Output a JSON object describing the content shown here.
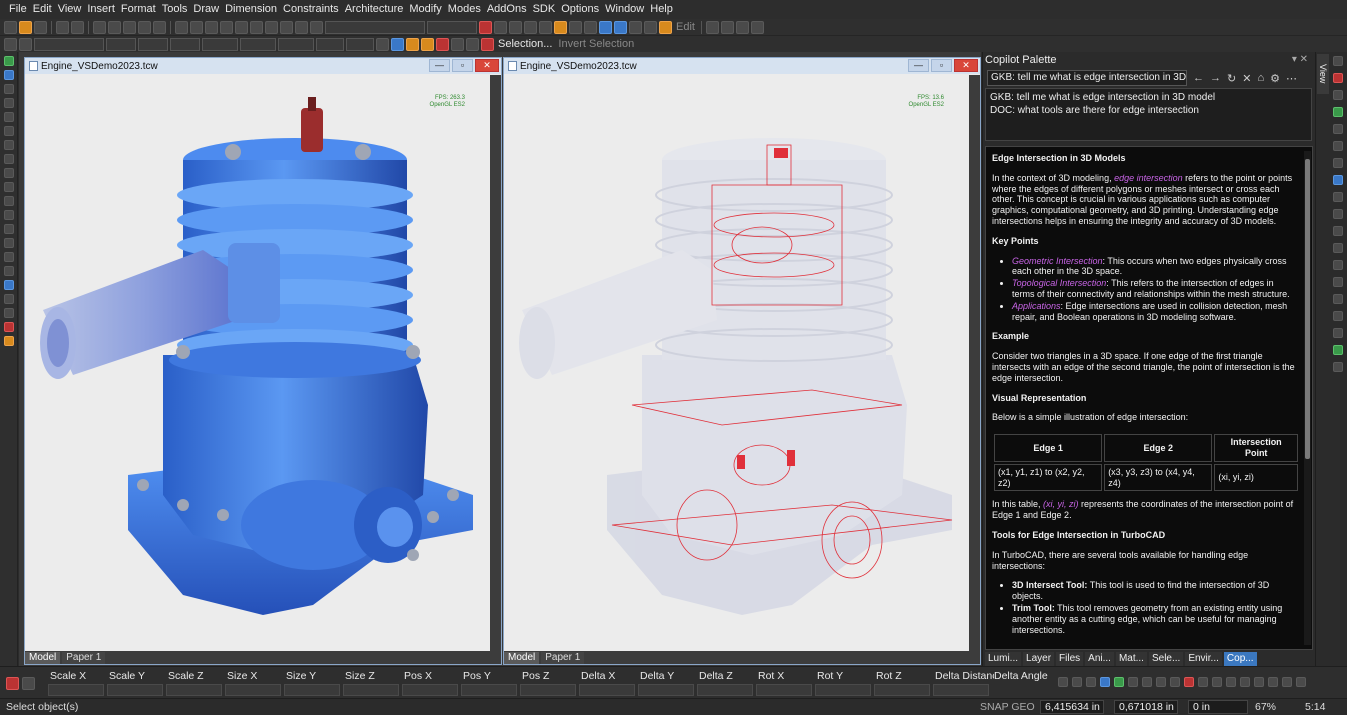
{
  "menu": [
    "File",
    "Edit",
    "View",
    "Insert",
    "Format",
    "Tools",
    "Draw",
    "Dimension",
    "Constraints",
    "Architecture",
    "Modify",
    "Modes",
    "AddOns",
    "SDK",
    "Options",
    "Window",
    "Help"
  ],
  "toolbar": {
    "edit_label": "Edit",
    "selection_label": "Selection...",
    "invert_selection_label": "Invert Selection"
  },
  "viewports": [
    {
      "title": "Engine_VSDemo2023.tcw",
      "fps": "FPS: 263.3",
      "renderer": "OpenGL ES2",
      "tab_model": "Model",
      "tab_paper": "Paper 1"
    },
    {
      "title": "Engine_VSDemo2023.tcw",
      "fps": "FPS: 13.6",
      "renderer": "OpenGL ES2",
      "tab_model": "Model",
      "tab_paper": "Paper 1"
    }
  ],
  "copilot": {
    "title": "Copilot Palette",
    "combo_value": "GKB: tell me what is edge intersection in 3D m",
    "history": [
      "GKB: tell me what is edge intersection in 3D model",
      "DOC:  what tools are there for edge intersection"
    ],
    "heading": "Edge Intersection in 3D Models",
    "intro_pre": "In the context of 3D modeling, ",
    "intro_term": "edge intersection",
    "intro_post": " refers to the point or points where the edges of different polygons or meshes intersect or cross each other. This concept is crucial in various applications such as computer graphics, computational geometry, and 3D printing. Understanding edge intersections helps in ensuring the integrity and accuracy of 3D models.",
    "key_points_heading": "Key Points",
    "key_points": [
      {
        "term": "Geometric Intersection",
        "text": ": This occurs when two edges physically cross each other in the 3D space."
      },
      {
        "term": "Topological Intersection",
        "text": ": This refers to the intersection of edges in terms of their connectivity and relationships within the mesh structure."
      },
      {
        "term": "Applications",
        "text": ": Edge intersections are used in collision detection, mesh repair, and Boolean operations in 3D modeling software."
      }
    ],
    "example_heading": "Example",
    "example_text": "Consider two triangles in a 3D space. If one edge of the first triangle intersects with an edge of the second triangle, the point of intersection is the edge intersection.",
    "visual_heading": "Visual Representation",
    "visual_text": "Below is a simple illustration of edge intersection:",
    "table": {
      "headers": [
        "Edge 1",
        "Edge 2",
        "Intersection Point"
      ],
      "row": [
        "(x1, y1, z1) to (x2, y2, z2)",
        "(x3, y3, z3) to (x4, y4, z4)",
        "(xi, yi, zi)"
      ]
    },
    "table_note_pre": "In this table, ",
    "table_note_term": "(xi, yi, zi)",
    "table_note_post": " represents the coordinates of the intersection point of Edge 1 and Edge 2.",
    "tools_heading": "Tools for Edge Intersection in TurboCAD",
    "tools_intro": "In TurboCAD, there are several tools available for handling edge intersections:",
    "tools": [
      {
        "name": "3D Intersect Tool:",
        "text": " This tool is used to find the intersection of 3D objects."
      },
      {
        "name": "Trim Tool:",
        "text": " This tool removes geometry from an existing entity using another entity as a cutting edge, which can be useful for managing intersections."
      }
    ],
    "tabs": [
      "Lumi...",
      "Layer",
      "Files",
      "Ani...",
      "Mat...",
      "Sele...",
      "Envir...",
      "Cop..."
    ],
    "active_tab": "Cop..."
  },
  "right_strip": {
    "view_tab": "View"
  },
  "inspector": {
    "labels": [
      "Scale X",
      "Scale Y",
      "Scale Z",
      "Size X",
      "Size Y",
      "Size Z",
      "Pos X",
      "Pos Y",
      "Pos Z",
      "Delta X",
      "Delta Y",
      "Delta Z",
      "Rot X",
      "Rot Y",
      "Rot Z",
      "Delta Distanc",
      "Delta Angle"
    ]
  },
  "status": {
    "text": "Select object(s)",
    "snap": "SNAP GEO",
    "coord_x": "6,415634 in",
    "coord_y": "0,671018 in",
    "coord_z": "0 in",
    "zoom": "67%",
    "time": "5:14"
  },
  "colors": {
    "accent": "#3b78c0",
    "highlight_term": "#c864e6",
    "engine_blue": "#3f7de0",
    "wire_red": "#e0303a"
  }
}
